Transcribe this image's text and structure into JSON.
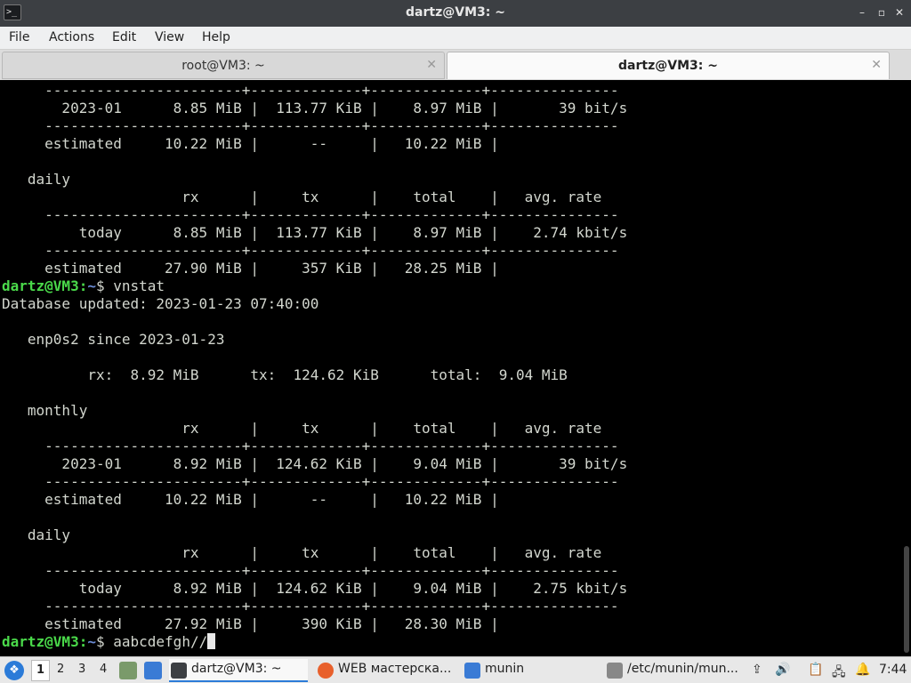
{
  "window": {
    "title": "dartz@VM3: ~",
    "app_icon": ">_",
    "controls": {
      "minimize": "–",
      "maximize": "▫",
      "close": "✕"
    }
  },
  "menu": [
    "File",
    "Actions",
    "Edit",
    "View",
    "Help"
  ],
  "tabs": [
    {
      "label": "root@VM3: ~",
      "active": false,
      "close": "✕"
    },
    {
      "label": "dartz@VM3: ~",
      "active": true,
      "close": "✕"
    }
  ],
  "terminal": {
    "lines": [
      "     -----------------------+-------------+-------------+---------------",
      "       2023-01      8.85 MiB |  113.77 KiB |    8.97 MiB |       39 bit/s",
      "     -----------------------+-------------+-------------+---------------",
      "     estimated     10.22 MiB |      --     |   10.22 MiB |",
      "",
      "   daily",
      "                     rx      |     tx      |    total    |   avg. rate",
      "     -----------------------+-------------+-------------+---------------",
      "         today      8.85 MiB |  113.77 KiB |    8.97 MiB |    2.74 kbit/s",
      "     -----------------------+-------------+-------------+---------------",
      "     estimated     27.90 MiB |     357 KiB |   28.25 MiB |",
      null,
      "Database updated: 2023-01-23 07:40:00",
      "",
      "   enp0s2 since 2023-01-23",
      "",
      "          rx:  8.92 MiB      tx:  124.62 KiB      total:  9.04 MiB",
      "",
      "   monthly",
      "                     rx      |     tx      |    total    |   avg. rate",
      "     -----------------------+-------------+-------------+---------------",
      "       2023-01      8.92 MiB |  124.62 KiB |    9.04 MiB |       39 bit/s",
      "     -----------------------+-------------+-------------+---------------",
      "     estimated     10.22 MiB |      --     |   10.22 MiB |",
      "",
      "   daily",
      "                     rx      |     tx      |    total    |   avg. rate",
      "     -----------------------+-------------+-------------+---------------",
      "         today      8.92 MiB |  124.62 KiB |    9.04 MiB |    2.75 kbit/s",
      "     -----------------------+-------------+-------------+---------------",
      "     estimated     27.92 MiB |     390 KiB |   28.30 MiB |",
      null
    ],
    "prompt_user": "dartz@VM3",
    "prompt_colon": ":",
    "prompt_path": "~",
    "prompt_symbol": "$ ",
    "command_1": "vnstat",
    "command_2": "aabcdefgh//"
  },
  "taskbar": {
    "start_icon": "❖",
    "workspaces": [
      "1",
      "2",
      "3",
      "4"
    ],
    "tasks": [
      {
        "label": "dartz@VM3: ~",
        "icon": "terminal-icon",
        "color": "#3c3f43"
      },
      {
        "label": "WEB мастерска...",
        "icon": "firefox-icon",
        "color": "#e8602c"
      },
      {
        "label": "munin",
        "icon": "folder-icon",
        "color": "#3a7bd5"
      },
      {
        "label": "/etc/munin/mun...",
        "icon": "text-editor-icon",
        "color": "#888888"
      }
    ],
    "clock": "7:44"
  }
}
